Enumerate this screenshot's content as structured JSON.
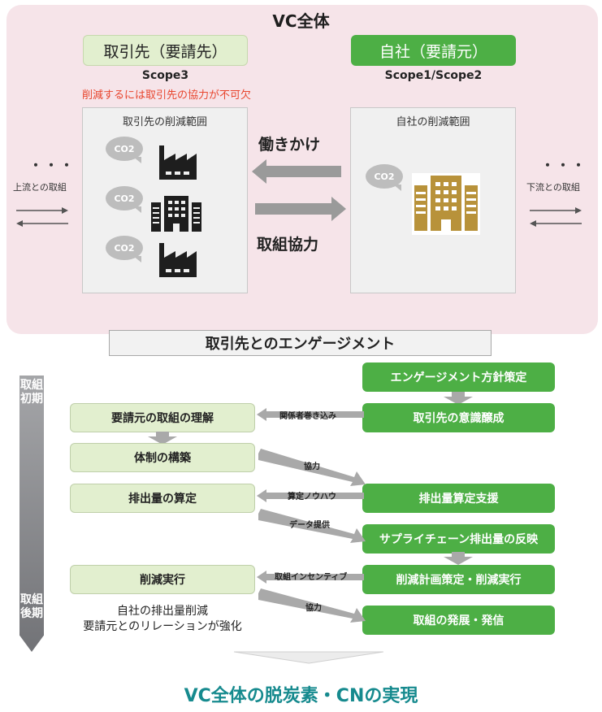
{
  "top": {
    "title": "VC全体",
    "supplier": {
      "role_label": "取引先（要請先）",
      "scope": "Scope3",
      "note": "削減するには取引先の協力が不可欠",
      "range_title": "取引先の削減範囲",
      "co2_label": "CO2"
    },
    "self": {
      "role_label": "自社（要請元）",
      "scope": "Scope1/Scope2",
      "range_title": "自社の削減範囲",
      "co2_label": "CO2"
    },
    "flow": {
      "to_supplier_label": "働きかけ",
      "to_self_label": "取組協力"
    },
    "upstream": {
      "dots": "・・・",
      "label": "上流との取組"
    },
    "downstream": {
      "dots": "・・・",
      "label": "下流との取組"
    }
  },
  "engagement": {
    "title": "取引先とのエンゲージメント",
    "phase_start": [
      "取組",
      "初期"
    ],
    "phase_end": [
      "取組",
      "後期"
    ],
    "left_steps": [
      "要請元の取組の理解",
      "体制の構築",
      "排出量の算定",
      "削減実行"
    ],
    "right_steps": [
      "エンゲージメント方針策定",
      "取引先の意識醸成",
      "排出量算定支援",
      "サプライチェーン排出量の反映",
      "削減計画策定・削減実行",
      "取組の発展・発信"
    ],
    "connectors": [
      "関係者巻き込み",
      "協力",
      "算定ノウハウ",
      "データ提供",
      "取組インセンティブ",
      "協力"
    ],
    "outcome": [
      "自社の排出量削減",
      "要請元とのリレーションが強化"
    ]
  },
  "conclusion": "VC全体の脱炭素・CNの実現",
  "colors": {
    "panel_bg": "#f6e4e9",
    "green": "#4daf45",
    "light_green": "#e2efcf",
    "red_note": "#e8462e",
    "teal_title": "#168a8e",
    "building_gold": "#b8923a",
    "arrow_gray": "#9a9a9a"
  }
}
